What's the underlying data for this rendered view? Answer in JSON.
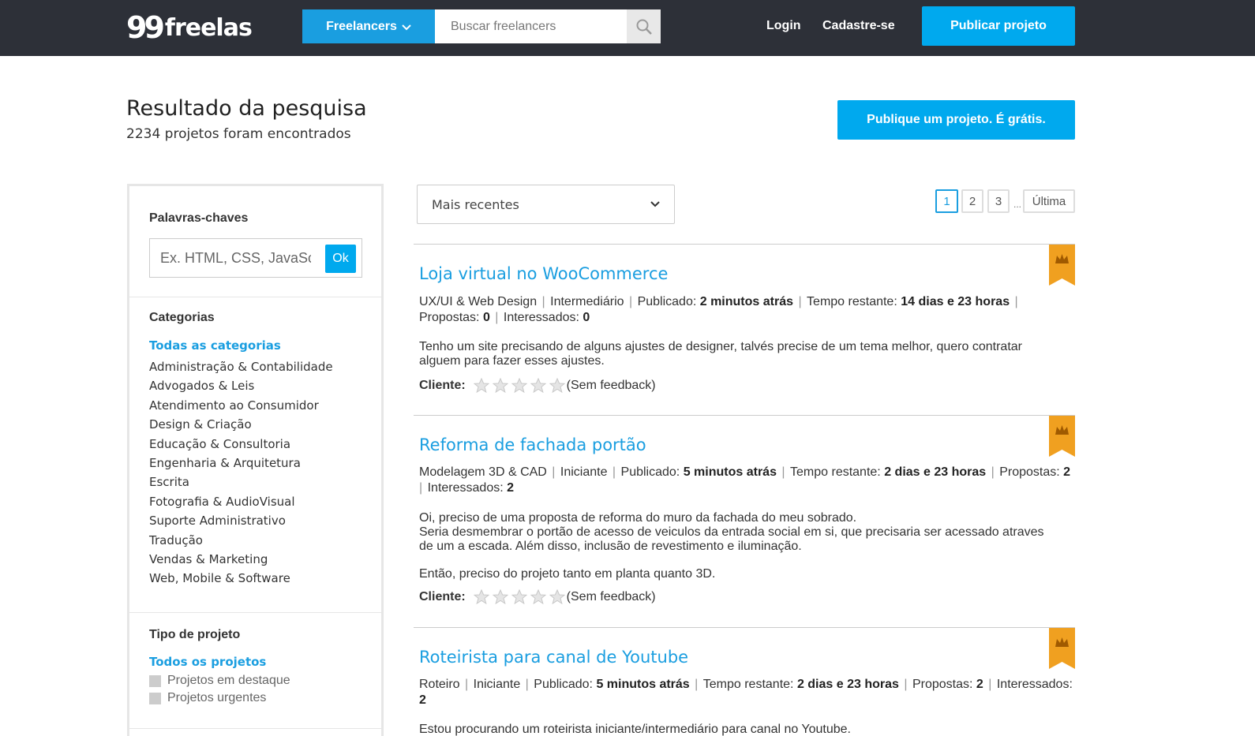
{
  "header": {
    "logo_num": "99",
    "logo_word": "freelas",
    "nav_dropdown": "Freelancers",
    "search_placeholder": "Buscar freelancers",
    "login": "Login",
    "signup": "Cadastre-se",
    "publish_button": "Publicar projeto"
  },
  "page": {
    "title": "Resultado da pesquisa",
    "subtitle": "2234 projetos foram encontrados",
    "publish_free_button": "Publique um projeto. É grátis."
  },
  "sidebar": {
    "keywords_heading": "Palavras-chaves",
    "keywords_placeholder": "Ex. HTML, CSS, JavaScript",
    "ok_button": "Ok",
    "categories_heading": "Categorias",
    "all_categories": "Todas as categorias",
    "categories": [
      "Administração & Contabilidade",
      "Advogados & Leis",
      "Atendimento ao Consumidor",
      "Design & Criação",
      "Educação & Consultoria",
      "Engenharia & Arquitetura",
      "Escrita",
      "Fotografia & AudioVisual",
      "Suporte Administrativo",
      "Tradução",
      "Vendas & Marketing",
      "Web, Mobile & Software"
    ],
    "project_type_heading": "Tipo de projeto",
    "all_projects": "Todos os projetos",
    "project_types": [
      "Projetos em destaque",
      "Projetos urgentes"
    ]
  },
  "sort": {
    "selected": "Mais recentes"
  },
  "pagination": {
    "pages": [
      "1",
      "2",
      "3"
    ],
    "dots": "...",
    "last": "Última",
    "current": "1"
  },
  "labels": {
    "published": "Publicado:",
    "remaining": "Tempo restante:",
    "proposals": "Propostas:",
    "interested": "Interessados:",
    "client": "Cliente:",
    "no_feedback": "(Sem feedback)"
  },
  "colors": {
    "accent": "#00a9ee",
    "link": "#1a9ee0",
    "header_bg": "#2d3038",
    "ribbon": "#f0a020"
  },
  "projects": [
    {
      "title": "Loja virtual no WooCommerce",
      "category": "UX/UI & Web Design",
      "level": "Intermediário",
      "published": "2 minutos atrás",
      "remaining": "14 dias e 23 horas",
      "proposals": "0",
      "interested": "0",
      "description": [
        "Tenho um site precisando de alguns ajustes de designer, talvés precise de um tema melhor, quero contratar alguem para fazer esses ajustes."
      ]
    },
    {
      "title": "Reforma de fachada portão",
      "category": "Modelagem 3D & CAD",
      "level": "Iniciante",
      "published": "5 minutos atrás",
      "remaining": "2 dias e 23 horas",
      "proposals": "2",
      "interested": "2",
      "description": [
        "Oi, preciso de uma proposta de reforma do muro da fachada do meu sobrado.",
        "Seria desmembrar o portão de acesso de veiculos da entrada social em si, que precisaria ser acessado atraves de um a escada. Além disso, inclusão de revestimento e iluminação.",
        "Então, preciso do projeto tanto em planta quanto 3D."
      ]
    },
    {
      "title": "Roteirista para canal de Youtube",
      "category": "Roteiro",
      "level": "Iniciante",
      "published": "5 minutos atrás",
      "remaining": "2 dias e 23 horas",
      "proposals": "2",
      "interested": "2",
      "description": [
        "Estou procurando um roteirista iniciante/intermediário para canal no Youtube."
      ]
    }
  ]
}
